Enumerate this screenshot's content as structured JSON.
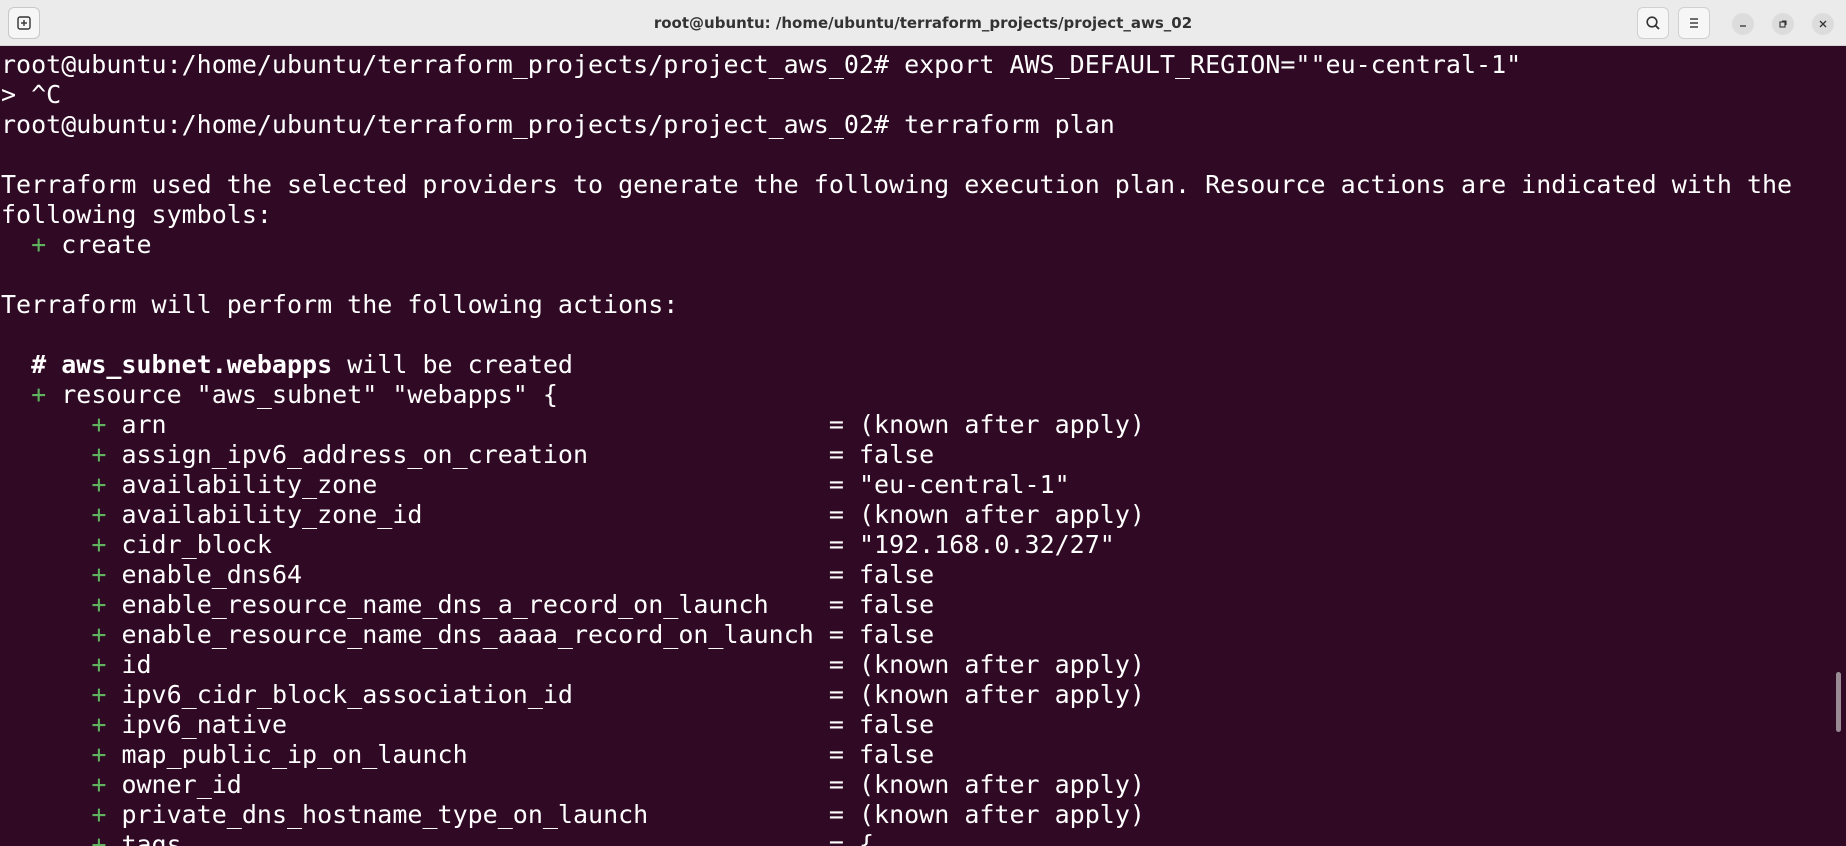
{
  "window": {
    "title": "root@ubuntu: /home/ubuntu/terraform_projects/project_aws_02"
  },
  "icons": {
    "new_tab": "new-tab-icon",
    "search": "search-icon",
    "menu": "hamburger-menu-icon",
    "minimize": "minimize-icon",
    "restore": "restore-icon",
    "close": "close-icon"
  },
  "colors": {
    "background": "#300a24",
    "text": "#ffffff",
    "plus": "#5fb35f"
  },
  "terminal": {
    "prompt": "root@ubuntu:/home/ubuntu/terraform_projects/project_aws_02#",
    "cmd1": " export AWS_DEFAULT_REGION=\"\"eu-central-1\"",
    "interrupt": "> ^C",
    "cmd2": " terraform plan",
    "intro1": "Terraform used the selected providers to generate the following execution plan. Resource actions are indicated with the",
    "intro2": "following symbols:",
    "legend_symbol": "+",
    "legend_label": " create",
    "actions_heading": "Terraform will perform the following actions:",
    "comment_hash": "# ",
    "resource_addr": "aws_subnet.webapps",
    "comment_tail": " will be created",
    "resource_decl": " resource \"aws_subnet\" \"webapps\" {",
    "attributes": [
      {
        "name": "arn",
        "value": "= (known after apply)"
      },
      {
        "name": "assign_ipv6_address_on_creation",
        "value": "= false"
      },
      {
        "name": "availability_zone",
        "value": "= \"eu-central-1\""
      },
      {
        "name": "availability_zone_id",
        "value": "= (known after apply)"
      },
      {
        "name": "cidr_block",
        "value": "= \"192.168.0.32/27\""
      },
      {
        "name": "enable_dns64",
        "value": "= false"
      },
      {
        "name": "enable_resource_name_dns_a_record_on_launch",
        "value": "= false"
      },
      {
        "name": "enable_resource_name_dns_aaaa_record_on_launch",
        "value": "= false"
      },
      {
        "name": "id",
        "value": "= (known after apply)"
      },
      {
        "name": "ipv6_cidr_block_association_id",
        "value": "= (known after apply)"
      },
      {
        "name": "ipv6_native",
        "value": "= false"
      },
      {
        "name": "map_public_ip_on_launch",
        "value": "= false"
      },
      {
        "name": "owner_id",
        "value": "= (known after apply)"
      },
      {
        "name": "private_dns_hostname_type_on_launch",
        "value": "= (known after apply)"
      },
      {
        "name": "tags",
        "value": "= {"
      }
    ]
  }
}
